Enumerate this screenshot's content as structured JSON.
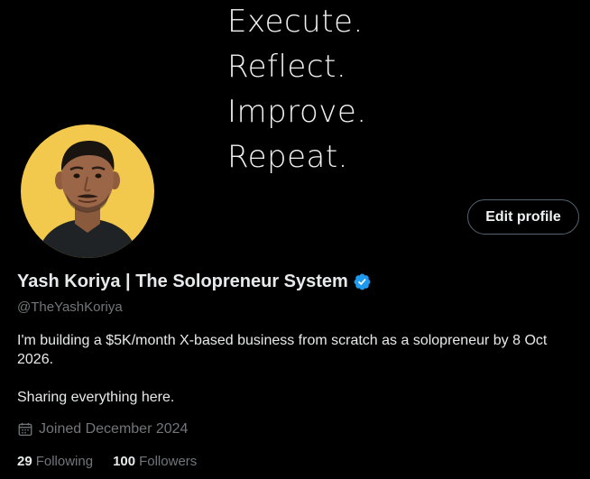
{
  "banner": {
    "lines": [
      "Execute.",
      "Reflect.",
      "Improve.",
      "Repeat."
    ]
  },
  "profile": {
    "display_name": "Yash Koriya | The Solopreneur System",
    "handle": "@TheYashKoriya",
    "verified_icon": "verified-badge-icon",
    "bio_paragraphs": [
      "I'm building a $5K/month X-based business from scratch as a solopreneur by 8 Oct 2026.",
      "Sharing everything here."
    ],
    "joined": "Joined December 2024"
  },
  "actions": {
    "edit_label": "Edit profile"
  },
  "stats": {
    "following_count": "29",
    "following_label": "Following",
    "followers_count": "100",
    "followers_label": "Followers"
  },
  "colors": {
    "background": "#000000",
    "primary_text": "#e7e9ea",
    "secondary_text": "#71767b",
    "verified_blue": "#1d9bf0",
    "avatar_bg": "#f2c94c",
    "button_border": "#536471"
  }
}
